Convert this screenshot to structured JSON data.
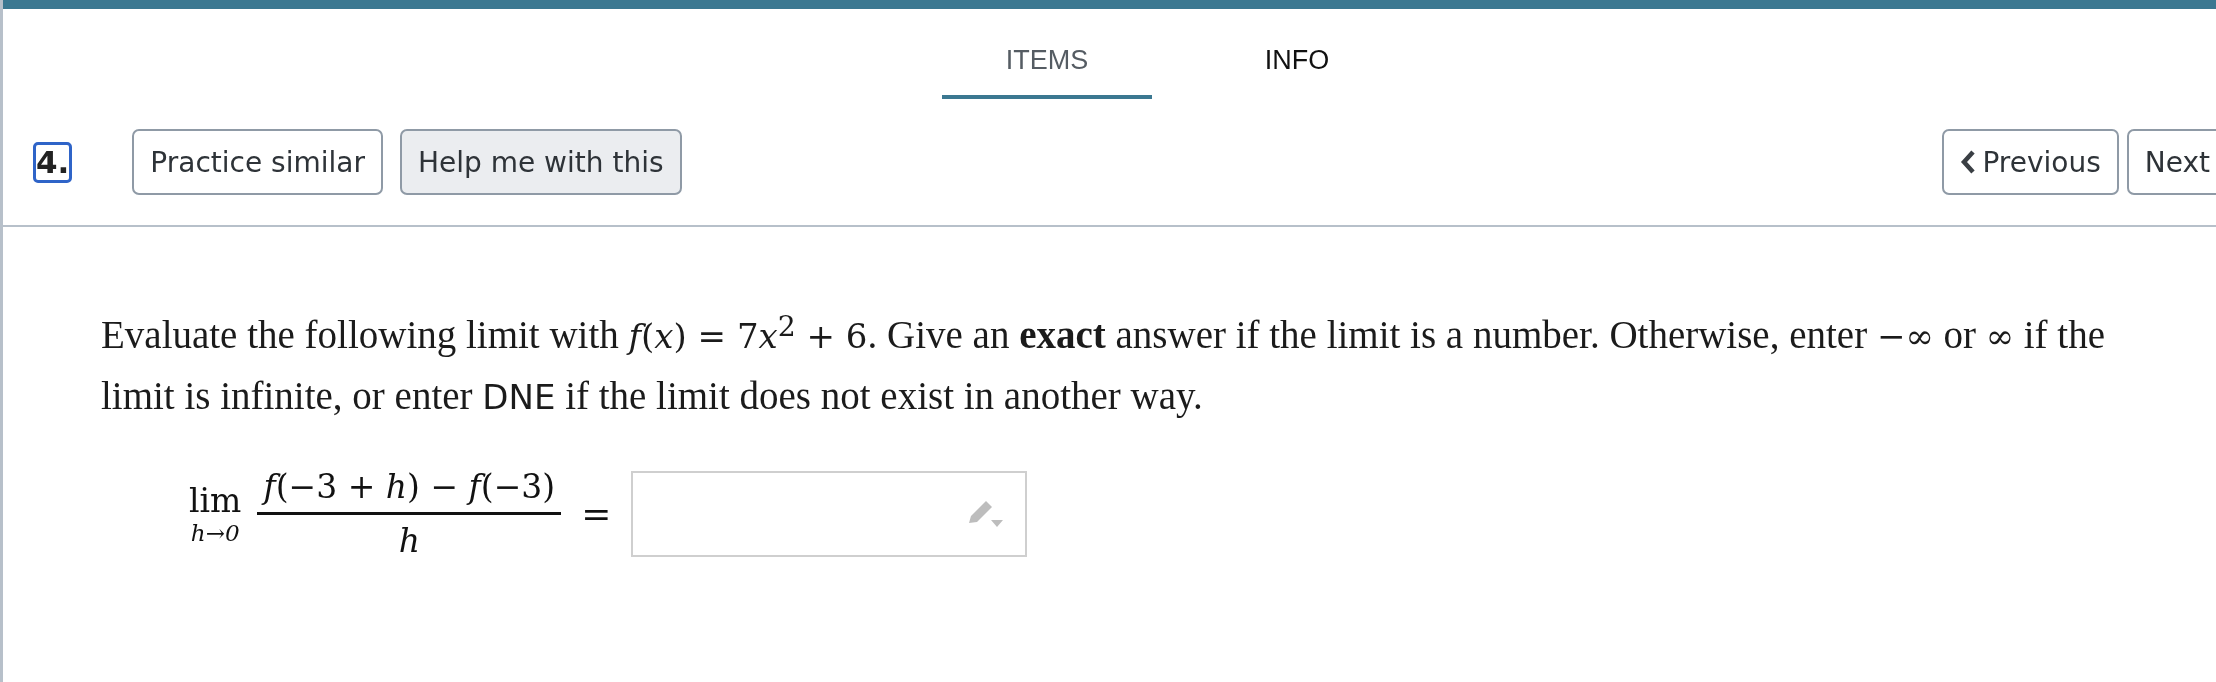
{
  "tabs": [
    {
      "label": "ITEMS",
      "selected": true
    },
    {
      "label": "INFO",
      "selected": false
    }
  ],
  "question_number": "4.",
  "actions": [
    {
      "label": "Practice similar",
      "kind": "outline"
    },
    {
      "label": "Help me with this",
      "kind": "filled"
    }
  ],
  "navigation": [
    {
      "label": "Previous",
      "kind": "previous"
    },
    {
      "label": "Next",
      "kind": "next"
    }
  ],
  "question": [
    {
      "kind": "text",
      "text": "Evaluate the following limit with "
    },
    {
      "kind": "math",
      "text": "*f*(*x*) = 7"
    },
    {
      "kind": "math",
      "text": "*x*$^{2}$ + 6"
    },
    {
      "kind": "text",
      "text": ". Give an **exact** answer if the limit is a number. Otherwise, enter "
    },
    {
      "kind": "math",
      "text": "−∞"
    },
    {
      "kind": "text",
      "text": " or "
    },
    {
      "kind": "math",
      "text": "∞"
    },
    {
      "kind": "text",
      "text": " if the limit is infinite, or enter "
    },
    {
      "kind": "code",
      "text": "DNE"
    },
    {
      "kind": "text",
      "text": " if the limit does not exist in another way."
    }
  ],
  "formula": {
    "operator": "lim",
    "subscript": "h→0",
    "numerator": "*f*(−3 + *h*) − *f*(−3)",
    "denominator": "*h*",
    "relation": "="
  }
}
